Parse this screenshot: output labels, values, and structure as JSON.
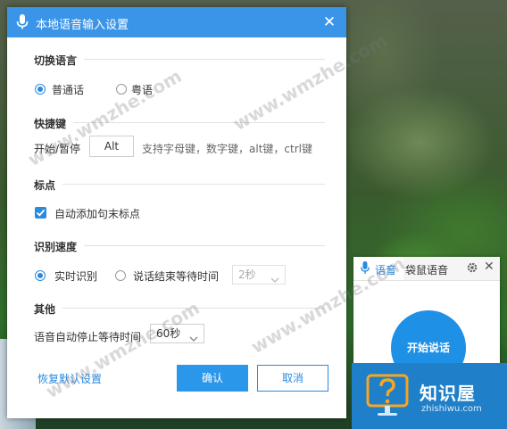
{
  "dialog": {
    "title": "本地语音输入设置",
    "close_glyph": "✕"
  },
  "language": {
    "heading": "切换语言",
    "options": [
      {
        "label": "普通话",
        "selected": true
      },
      {
        "label": "粤语",
        "selected": false
      }
    ]
  },
  "hotkey": {
    "heading": "快捷键",
    "label": "开始/暂停",
    "value": "Alt",
    "hint": "支持字母键，数字键，alt键，ctrl键"
  },
  "punctuation": {
    "heading": "标点",
    "checkbox_label": "自动添加句末标点",
    "checked": true
  },
  "speed": {
    "heading": "识别速度",
    "realtime_label": "实时识别",
    "realtime_selected": true,
    "wait_label": "说话结束等待时间",
    "wait_selected": false,
    "wait_value": "2秒"
  },
  "other": {
    "heading": "其他",
    "auto_stop_label": "语音自动停止等待时间",
    "auto_stop_value": "60秒"
  },
  "footer": {
    "restore_label": "恢复默认设置",
    "ok_label": "确认",
    "cancel_label": "取消"
  },
  "voice_panel": {
    "tab_voice": "语音",
    "tab_kangaroo": "袋鼠语音",
    "close_glyph": "✕",
    "start_label": "开始说话"
  },
  "logo": {
    "main": "知识屋",
    "sub": "zhishiwu.com"
  },
  "watermark": "www.wmzhe.com",
  "colors": {
    "accent": "#3a95e8",
    "primary_button": "#2b97ea",
    "link": "#2a8ae0"
  },
  "icons": {
    "title": "microphone-icon",
    "checkbox": "checkmark-icon",
    "dropdown": "chevron-down-icon",
    "settings": "gear-icon",
    "logo": "question-monitor-icon"
  }
}
